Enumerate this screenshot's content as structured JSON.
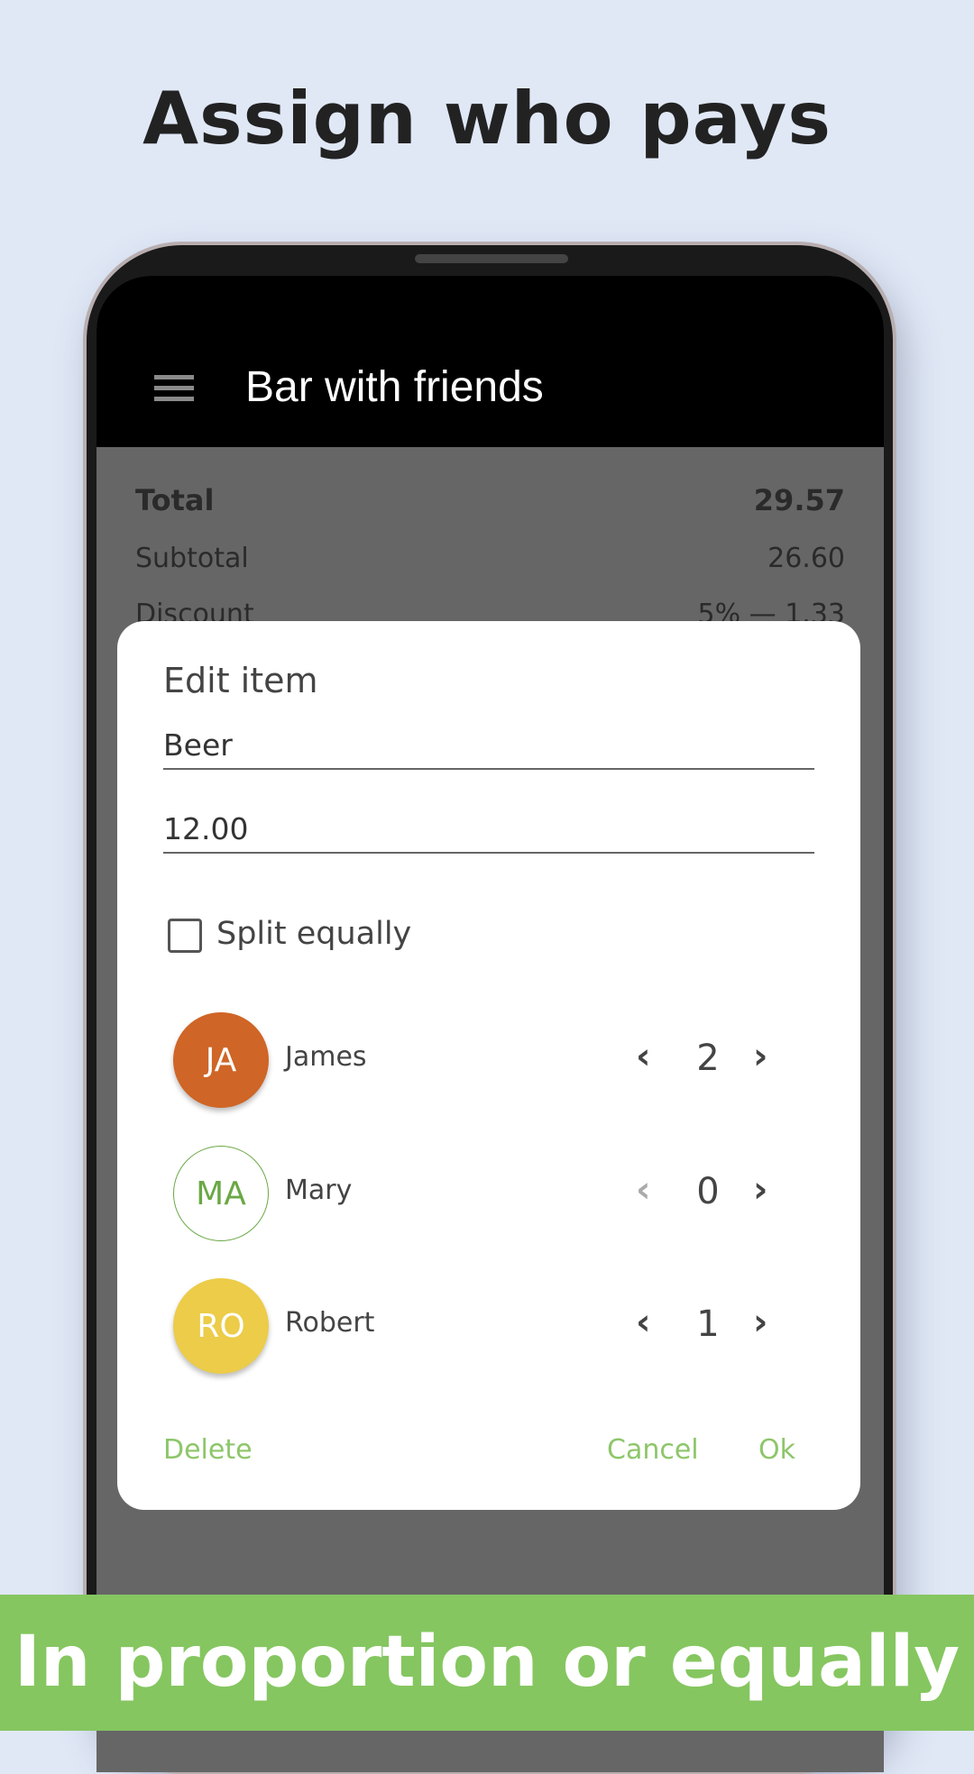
{
  "headline": "Assign who pays",
  "banner": "In proportion or equally",
  "app": {
    "title": "Bar with friends",
    "menu_icon": "hamburger-menu-icon"
  },
  "summary": {
    "total_label": "Total",
    "total_value": "29.57",
    "subtotal_label": "Subtotal",
    "subtotal_value": "26.60",
    "discount_label": "Discount",
    "discount_value": "5% — 1.33"
  },
  "dialog": {
    "title": "Edit item",
    "name_value": "Beer",
    "price_value": "12.00",
    "split_label": "Split equally",
    "split_checked": false,
    "people": [
      {
        "initials": "JA",
        "name": "James",
        "count": "2",
        "color": "#cf6526",
        "decrement_enabled": true
      },
      {
        "initials": "MA",
        "name": "Mary",
        "count": "0",
        "color": "#6aa845",
        "decrement_enabled": false
      },
      {
        "initials": "RO",
        "name": "Robert",
        "count": "1",
        "color": "#eccc48",
        "decrement_enabled": true
      }
    ],
    "delete_label": "Delete",
    "cancel_label": "Cancel",
    "ok_label": "Ok"
  },
  "colors": {
    "background": "#e0e8f6",
    "accent_green": "#85c660",
    "button_text": "#8dc66a"
  }
}
